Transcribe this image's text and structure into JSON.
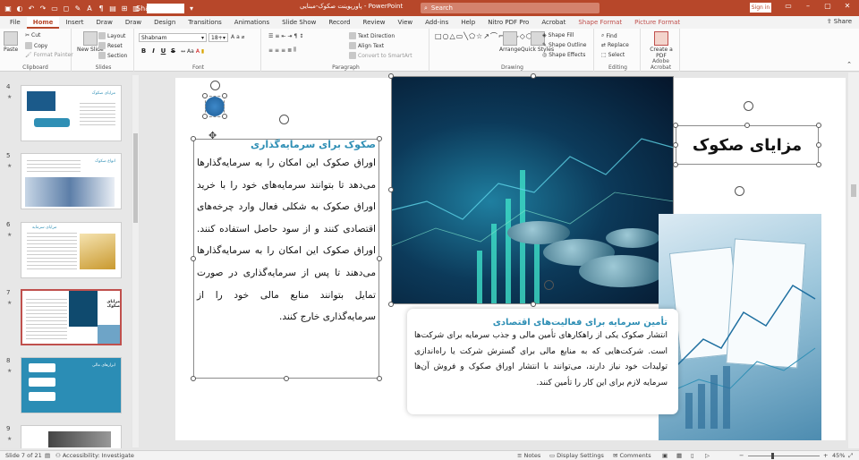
{
  "titlebar": {
    "font_name": "Shabnam",
    "document_title": "پاورپوینت صکوک-مبنایی  -  PowerPoint",
    "search_label": "Search",
    "signin_label": "Sign in",
    "colors": {
      "bar": "#b7472a"
    }
  },
  "tabs": [
    "File",
    "Home",
    "Insert",
    "Draw",
    "Draw",
    "Design",
    "Transitions",
    "Animations",
    "Slide Show",
    "Record",
    "Review",
    "View",
    "Add-ins",
    "Help",
    "Nitro PDF Pro",
    "Acrobat",
    "Shape Format",
    "Picture Format"
  ],
  "share_label": "Share",
  "ribbon": {
    "clipboard": {
      "paste": "Paste",
      "cut": "Cut",
      "copy": "Copy",
      "format_painter": "Format Painter",
      "label": "Clipboard"
    },
    "slides": {
      "new_slide": "New Slide",
      "layout": "Layout",
      "reset": "Reset",
      "section": "Section",
      "label": "Slides"
    },
    "font": {
      "name": "Shabnam",
      "size": "18+",
      "label": "Font",
      "bold": "B",
      "italic": "I",
      "underline": "U",
      "strike": "S"
    },
    "paragraph": {
      "text_direction": "Text Direction",
      "align_text": "Align Text",
      "smartart": "Convert to SmartArt",
      "label": "Paragraph"
    },
    "drawing": {
      "arrange": "Arrange",
      "quick_styles": "Quick Styles",
      "shape_fill": "Shape Fill",
      "shape_outline": "Shape Outline",
      "shape_effects": "Shape Effects",
      "label": "Drawing"
    },
    "editing": {
      "find": "Find",
      "replace": "Replace",
      "select": "Select",
      "label": "Editing"
    },
    "acrobat": {
      "create_pdf": "Create a PDF",
      "label": "Adobe Acrobat"
    }
  },
  "thumbnails": [
    {
      "num": "4",
      "title": "مزایای صکوک"
    },
    {
      "num": "5",
      "title": "انواع صکوک"
    },
    {
      "num": "6",
      "title": "مزایای سرمایه"
    },
    {
      "num": "7",
      "title": "مزایای صکوک"
    },
    {
      "num": "8",
      "title": "ابزارهای مالی"
    },
    {
      "num": "9",
      "title": ""
    }
  ],
  "slide": {
    "left_heading": "صکوک برای سرمایه‌گذاری",
    "left_body": "اوراق صکوک این امکان را به سرمایه‌گذارها می‌دهد تا بتوانند سرمایه‌های خود را با خرید اوراق صکوک به شکلی فعال وارد چرخه‌های اقتصادی کنند و از سود حاصل استفاده کنند. اوراق صکوک این امکان را به سرمایه‌گذارها می‌دهند تا پس از سرمایه‌گذاری در صورت تمایل بتوانند منابع مالی خود را از سرمایه‌گذاری خارج کنند.",
    "title": "مزایای صکوک",
    "bottom_heading": "تأمین سرمایه برای فعالیت‌های اقتصادی",
    "bottom_body": "انتشار صکوک یکی از راهکارهای تأمین مالی و جذب سرمایه برای شرکت‌ها است. شرکت‌هایی که به منابع مالی برای گسترش شرکت یا راه‌اندازی تولیدات خود نیاز دارند، می‌توانند با انتشار اوراق صکوک و فروش آن‌ها سرمایه لازم برای این کار را تأمین کنند.",
    "colors": {
      "heading": "#2f8fb5"
    }
  },
  "statusbar": {
    "slide_info": "Slide 7 of 21",
    "accessibility": "Accessibility: Investigate",
    "notes": "Notes",
    "display_settings": "Display Settings",
    "comments": "Comments",
    "zoom": "45%"
  }
}
